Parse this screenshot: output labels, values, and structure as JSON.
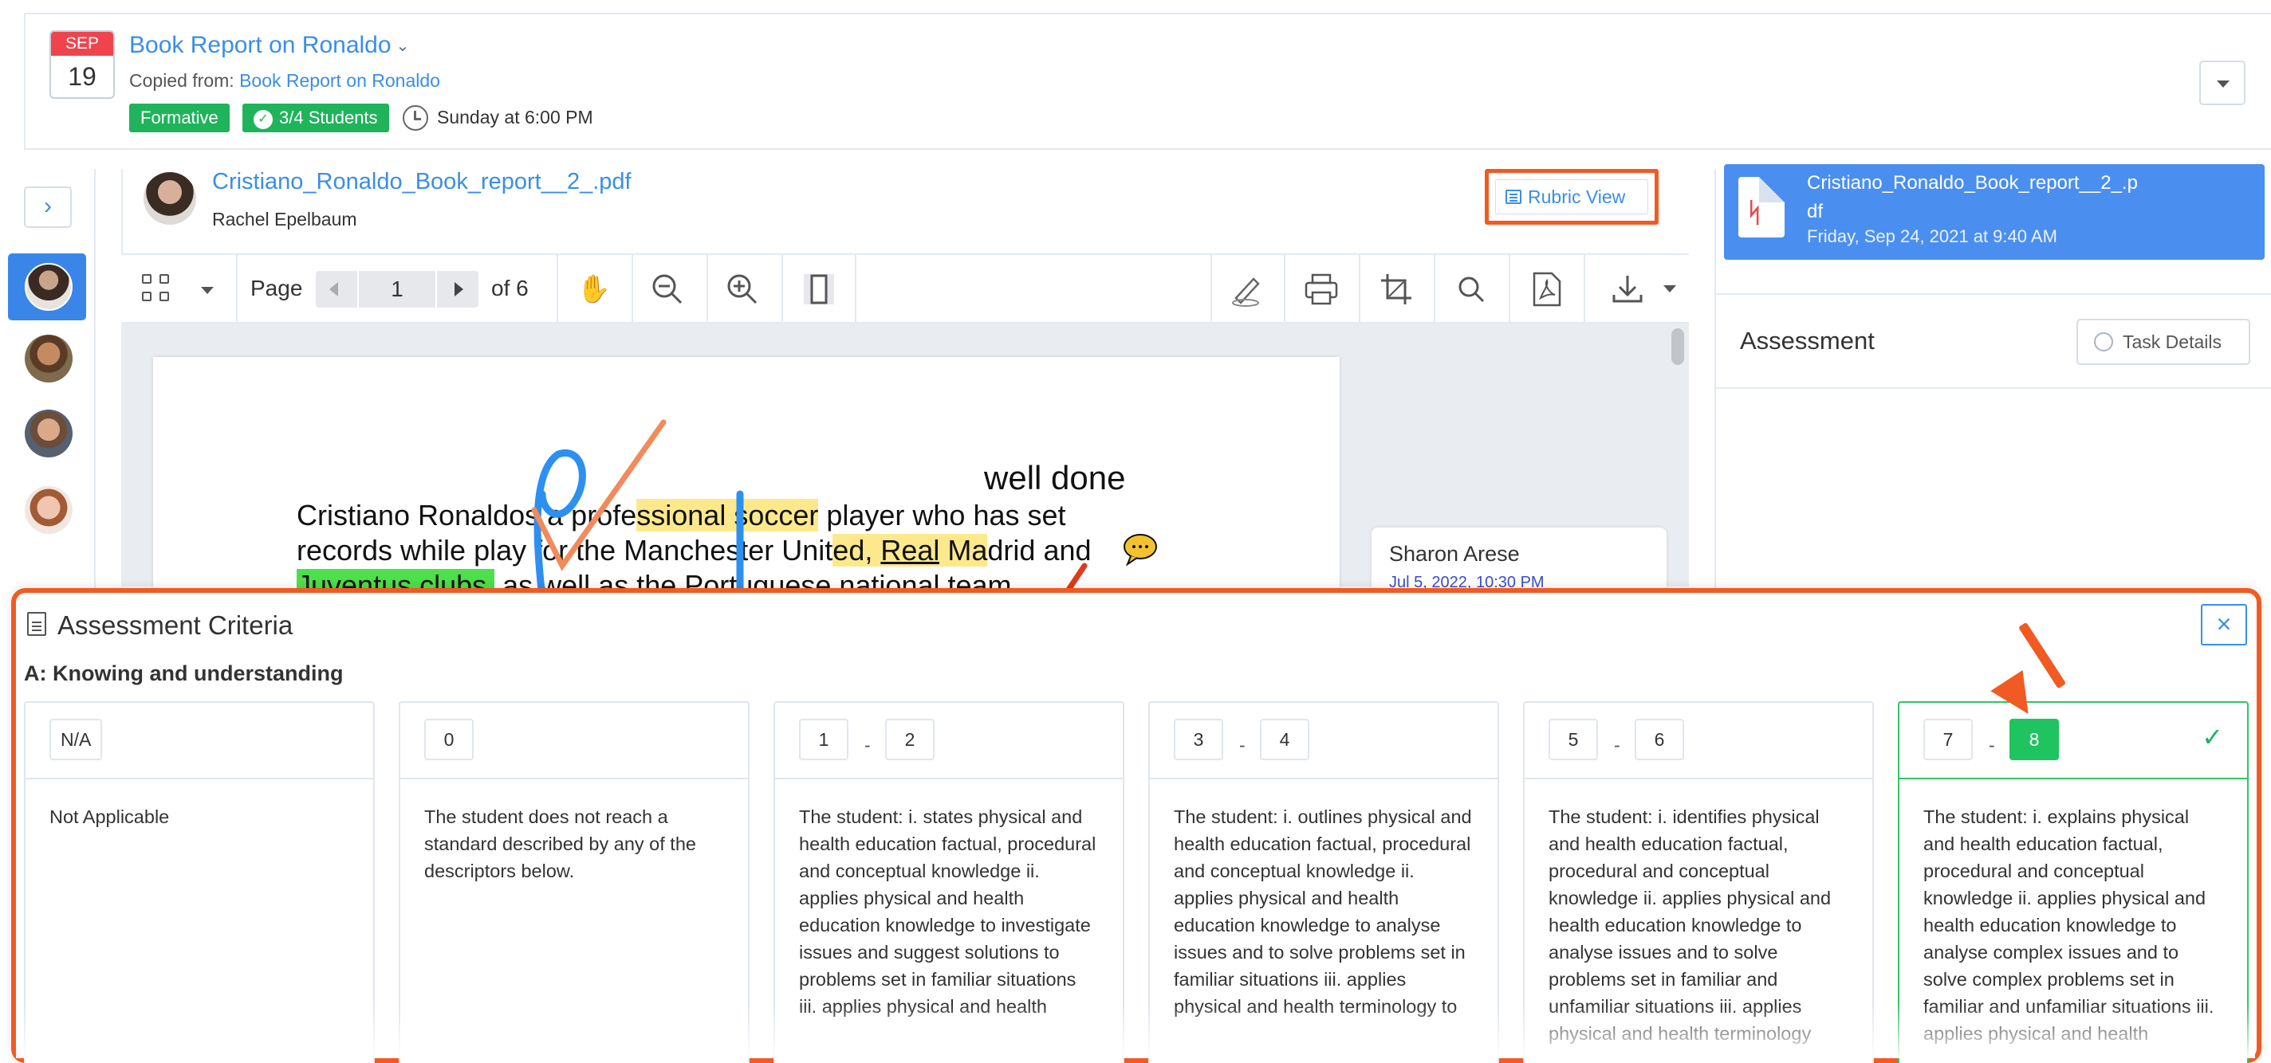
{
  "header": {
    "calendar_month": "SEP",
    "calendar_day": "19",
    "task_title": "Book Report on Ronaldo",
    "copied_from_label": "Copied from:",
    "copied_from_link": "Book Report on Ronaldo",
    "badge_formative": "Formative",
    "badge_students": "3/4 Students",
    "due": "Sunday at 6:00 PM"
  },
  "file": {
    "name": "Cristiano_Ronaldo_Book_report__2_.pdf",
    "student": "Rachel Epelbaum",
    "rubric_view_label": "Rubric View"
  },
  "toolbar": {
    "page_label": "Page",
    "page_number": "1",
    "of_label": "of 6"
  },
  "document": {
    "annotation": "well done",
    "line1_a": "Cristiano Ronaldo",
    "line1_b": "s a profe",
    "line1_c": "ssional soccer",
    "line1_d": " player who has set",
    "line2_a": "records while play",
    "line2_b": " for the Manchester Unit",
    "line2_c": "ed, ",
    "line2_d": "Real",
    "line2_e": " Ma",
    "line2_f": "drid and",
    "line3_a": "Juventus clubs,",
    "line3_b": " as well as the Portuguese national team."
  },
  "comment": {
    "author": "Sharon Arese",
    "date": "Jul 5, 2022, 10:30 PM"
  },
  "right_panel": {
    "file_name": "Cristiano_Ronaldo_Book_report__2_.pdf",
    "file_date": "Friday, Sep 24, 2021 at 9:40 AM",
    "assessment_title": "Assessment",
    "task_details_label": "Task Details"
  },
  "criteria": {
    "title": "Assessment Criteria",
    "section": "A: Knowing and understanding",
    "close_label": "×",
    "columns": [
      {
        "scores": [
          "N/A"
        ],
        "description": "Not Applicable"
      },
      {
        "scores": [
          "0"
        ],
        "description": "The student does not reach a standard described by any of the descriptors below."
      },
      {
        "scores": [
          "1",
          "2"
        ],
        "description": "The student: i. states physical and health education factual, procedural and conceptual knowledge ii. applies physical and health education knowledge to investigate issues and suggest solutions to problems set in familiar situations iii. applies physical and health"
      },
      {
        "scores": [
          "3",
          "4"
        ],
        "description": "The student: i. outlines physical and health education factual, procedural and conceptual knowledge ii. applies physical and health education knowledge to analyse issues and to solve problems set in familiar situations iii. applies physical and health terminology to"
      },
      {
        "scores": [
          "5",
          "6"
        ],
        "description": "The student: i. identifies physical and health education factual, procedural and conceptual knowledge ii. applies physical and health education knowledge to analyse issues and to solve problems set in familiar and unfamiliar situations iii. applies physical and health terminology"
      },
      {
        "scores": [
          "7",
          "8"
        ],
        "description": "The student: i. explains physical and health education factual, procedural and conceptual knowledge ii. applies physical and health education knowledge to analyse complex issues and to solve complex problems set in familiar and unfamiliar situations iii. applies physical and health"
      }
    ],
    "selected_score": "8"
  },
  "colors": {
    "accent": "#3a8ee6",
    "success": "#1fb45b",
    "highlight_orange": "#f15a22",
    "calendar_red": "#f0444d"
  }
}
